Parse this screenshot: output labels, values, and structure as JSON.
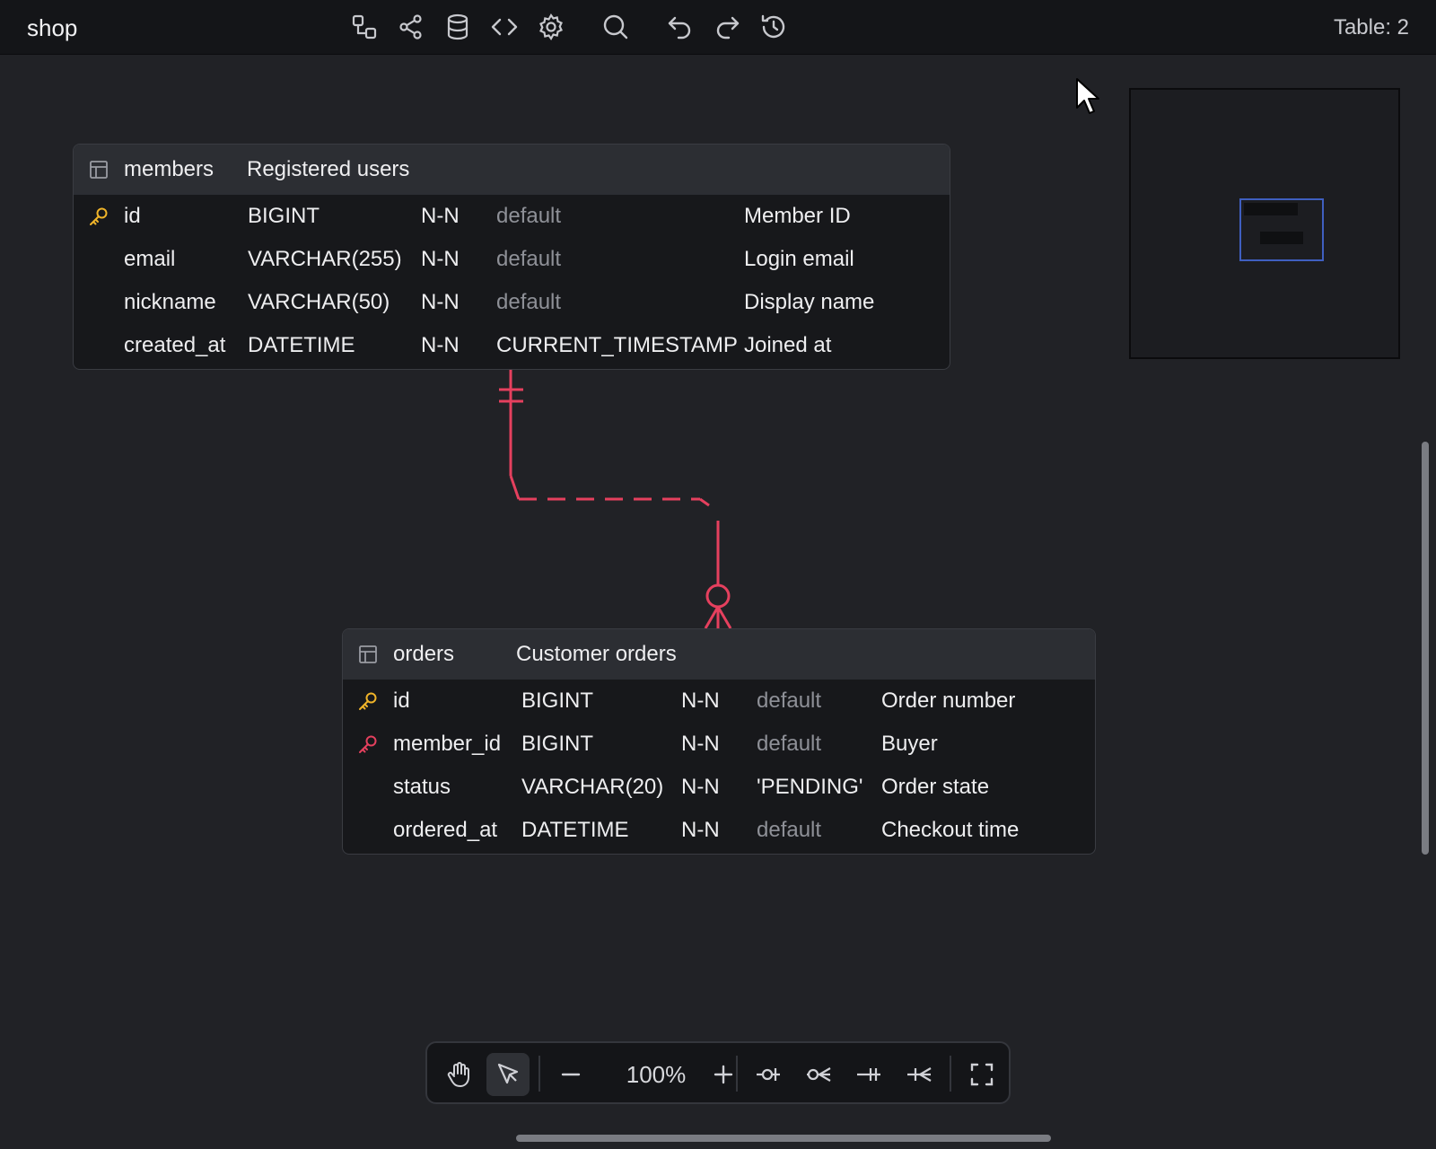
{
  "topbar": {
    "project_name": "shop",
    "table_count": "Table: 2",
    "icons": [
      "relationship-icon",
      "share-icon",
      "database-icon",
      "code-icon",
      "settings-icon",
      "search-icon",
      "undo-icon",
      "redo-icon",
      "history-icon"
    ]
  },
  "tables": [
    {
      "name": "members",
      "comment": "Registered users",
      "columns": [
        {
          "key": "primary",
          "name": "id",
          "type": "BIGINT",
          "nullable": "N-N",
          "default": "default",
          "default_is_placeholder": true,
          "comment": "Member ID"
        },
        {
          "key": "",
          "name": "email",
          "type": "VARCHAR(255)",
          "nullable": "N-N",
          "default": "default",
          "default_is_placeholder": true,
          "comment": "Login email"
        },
        {
          "key": "",
          "name": "nickname",
          "type": "VARCHAR(50)",
          "nullable": "N-N",
          "default": "default",
          "default_is_placeholder": true,
          "comment": "Display name"
        },
        {
          "key": "",
          "name": "created_at",
          "type": "DATETIME",
          "nullable": "N-N",
          "default": "CURRENT_TIMESTAMP",
          "default_is_placeholder": false,
          "comment": "Joined at"
        }
      ]
    },
    {
      "name": "orders",
      "comment": "Customer orders",
      "columns": [
        {
          "key": "primary",
          "name": "id",
          "type": "BIGINT",
          "nullable": "N-N",
          "default": "default",
          "default_is_placeholder": true,
          "comment": "Order number"
        },
        {
          "key": "foreign",
          "name": "member_id",
          "type": "BIGINT",
          "nullable": "N-N",
          "default": "default",
          "default_is_placeholder": true,
          "comment": "Buyer"
        },
        {
          "key": "",
          "name": "status",
          "type": "VARCHAR(20)",
          "nullable": "N-N",
          "default": "'PENDING'",
          "default_is_placeholder": false,
          "comment": "Order state"
        },
        {
          "key": "",
          "name": "ordered_at",
          "type": "DATETIME",
          "nullable": "N-N",
          "default": "default",
          "default_is_placeholder": true,
          "comment": "Checkout time"
        }
      ]
    }
  ],
  "relationship": {
    "from": "members.id",
    "to": "orders.member_id",
    "from_cardinality": "one-only",
    "to_cardinality": "zero-or-many",
    "line_style": "dashed",
    "color": "#e5405e"
  },
  "colors": {
    "primary_key": "#f0b429",
    "foreign_key": "#e5405e",
    "relationship": "#e5405e",
    "minimap_viewport": "#3f5fc0"
  },
  "bottom_toolbar": {
    "zoom": "100%",
    "tools": [
      "hand-icon",
      "pointer-icon",
      "zoom-out-icon",
      "zoom-in-icon",
      "zero-one-icon",
      "zero-many-icon",
      "one-only-icon",
      "one-many-icon",
      "fullscreen-icon"
    ],
    "active_tool": "pointer-icon"
  }
}
